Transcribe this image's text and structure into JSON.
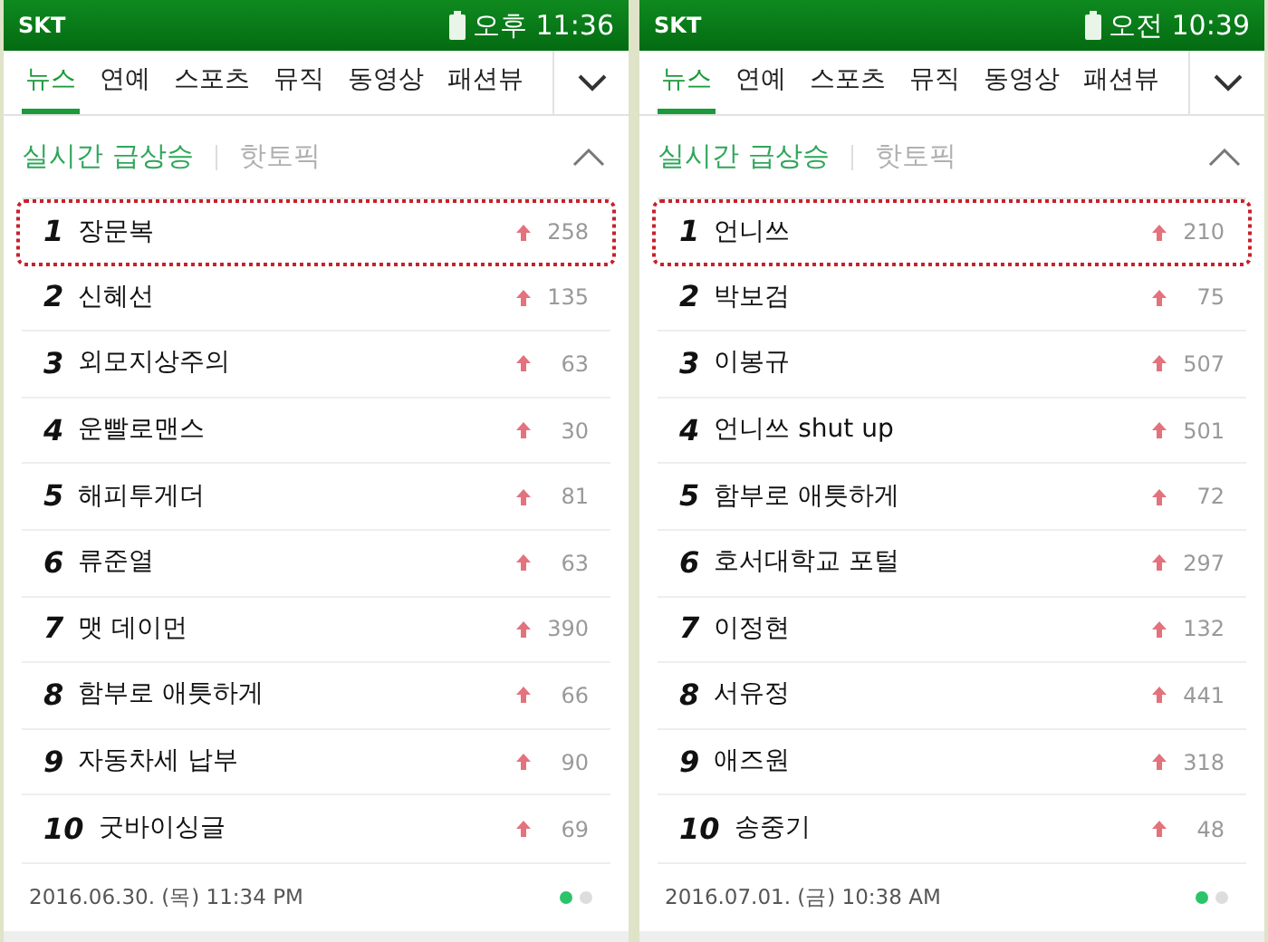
{
  "phones": [
    {
      "status_bar": {
        "carrier": "SKT",
        "time": "오후 11:36"
      },
      "tabs": [
        {
          "label": "뉴스",
          "selected": true
        },
        {
          "label": "연예",
          "selected": false
        },
        {
          "label": "스포츠",
          "selected": false
        },
        {
          "label": "뮤직",
          "selected": false
        },
        {
          "label": "동영상",
          "selected": false
        },
        {
          "label": "패션뷰",
          "selected": false
        }
      ],
      "section_tabs": [
        {
          "label": "실시간 급상승",
          "selected": true
        },
        {
          "label": "핫토픽",
          "selected": false
        }
      ],
      "keywords": [
        {
          "rank": "1",
          "keyword": "장문복",
          "change": "258",
          "highlighted": true
        },
        {
          "rank": "2",
          "keyword": "신혜선",
          "change": "135",
          "highlighted": false
        },
        {
          "rank": "3",
          "keyword": "외모지상주의",
          "change": "63",
          "highlighted": false
        },
        {
          "rank": "4",
          "keyword": "운빨로맨스",
          "change": "30",
          "highlighted": false
        },
        {
          "rank": "5",
          "keyword": "해피투게더",
          "change": "81",
          "highlighted": false
        },
        {
          "rank": "6",
          "keyword": "류준열",
          "change": "63",
          "highlighted": false
        },
        {
          "rank": "7",
          "keyword": "맷 데이먼",
          "change": "390",
          "highlighted": false
        },
        {
          "rank": "8",
          "keyword": "함부로 애틋하게",
          "change": "66",
          "highlighted": false
        },
        {
          "rank": "9",
          "keyword": "자동차세 납부",
          "change": "90",
          "highlighted": false
        },
        {
          "rank": "10",
          "keyword": "굿바이싱글",
          "change": "69",
          "highlighted": false
        }
      ],
      "timestamp": "2016.06.30. (목) 11:34 PM",
      "pages": [
        {
          "selected": true
        },
        {
          "selected": false
        }
      ]
    },
    {
      "status_bar": {
        "carrier": "SKT",
        "time": "오전 10:39"
      },
      "tabs": [
        {
          "label": "뉴스",
          "selected": true
        },
        {
          "label": "연예",
          "selected": false
        },
        {
          "label": "스포츠",
          "selected": false
        },
        {
          "label": "뮤직",
          "selected": false
        },
        {
          "label": "동영상",
          "selected": false
        },
        {
          "label": "패션뷰",
          "selected": false
        }
      ],
      "section_tabs": [
        {
          "label": "실시간 급상승",
          "selected": true
        },
        {
          "label": "핫토픽",
          "selected": false
        }
      ],
      "keywords": [
        {
          "rank": "1",
          "keyword": "언니쓰",
          "change": "210",
          "highlighted": true
        },
        {
          "rank": "2",
          "keyword": "박보검",
          "change": "75",
          "highlighted": false
        },
        {
          "rank": "3",
          "keyword": "이봉규",
          "change": "507",
          "highlighted": false
        },
        {
          "rank": "4",
          "keyword": "언니쓰 shut up",
          "change": "501",
          "highlighted": false
        },
        {
          "rank": "5",
          "keyword": "함부로 애틋하게",
          "change": "72",
          "highlighted": false
        },
        {
          "rank": "6",
          "keyword": "호서대학교 포털",
          "change": "297",
          "highlighted": false
        },
        {
          "rank": "7",
          "keyword": "이정현",
          "change": "132",
          "highlighted": false
        },
        {
          "rank": "8",
          "keyword": "서유정",
          "change": "441",
          "highlighted": false
        },
        {
          "rank": "9",
          "keyword": "애즈원",
          "change": "318",
          "highlighted": false
        },
        {
          "rank": "10",
          "keyword": "송중기",
          "change": "48",
          "highlighted": false
        }
      ],
      "timestamp": "2016.07.01. (금) 10:38 AM",
      "pages": [
        {
          "selected": true
        },
        {
          "selected": false
        }
      ]
    }
  ]
}
